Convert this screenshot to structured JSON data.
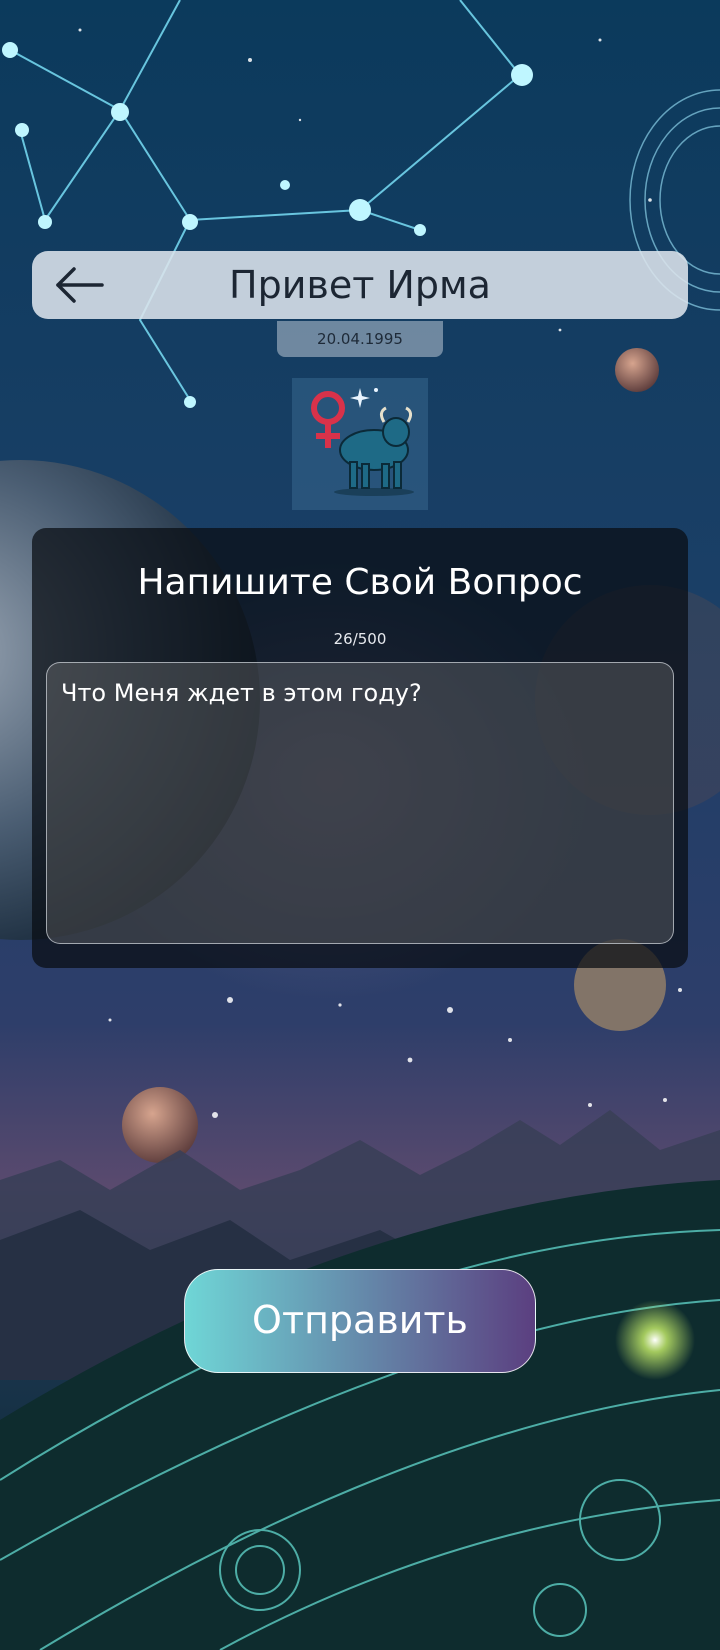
{
  "header": {
    "title": "Привет Ирма",
    "back_icon": "arrow-left-icon"
  },
  "profile": {
    "birth_date": "20.04.1995",
    "zodiac_icon": "venus-taurus-bull-icon"
  },
  "question_panel": {
    "title": "Напишите Свой Вопрос",
    "counter": "26/500",
    "input_value": "Что Меня ждет в этом году?"
  },
  "send_button": {
    "label": "Отправить",
    "gradient_start": "#6fd6d6",
    "gradient_end": "#5b3f80"
  },
  "colors": {
    "header_bg": "#dce4ec",
    "panel_bg": "#080c12",
    "text_light": "#ffffff",
    "text_dark": "#1c2633"
  }
}
